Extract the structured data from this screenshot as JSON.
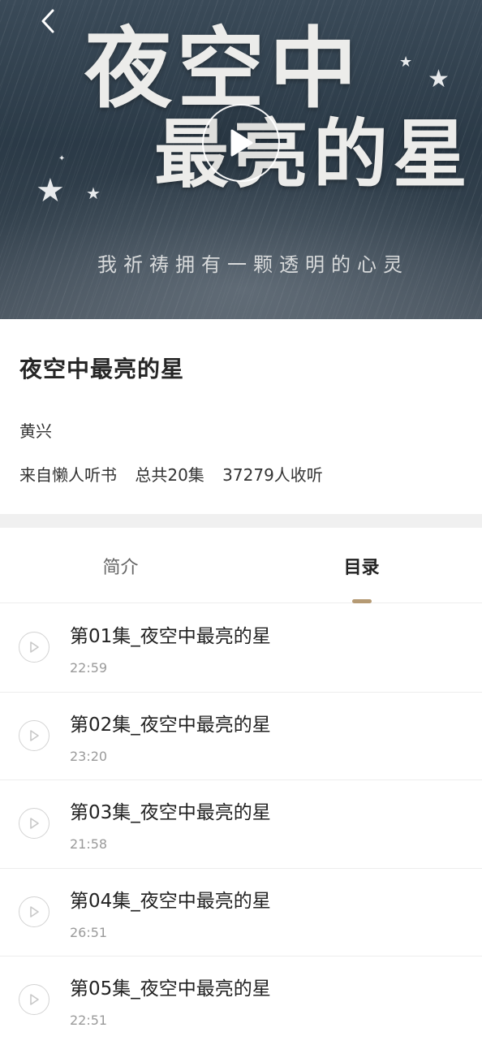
{
  "cover": {
    "title_line1": "夜空中",
    "title_line2": "最亮的星",
    "subtitle": "我祈祷拥有一颗透明的心灵",
    "back_icon": "chevron-left-icon",
    "play_icon": "play-icon"
  },
  "book": {
    "title": "夜空中最亮的星",
    "author": "黄兴",
    "source": "来自懒人听书",
    "episode_count": "总共20集",
    "listeners": "37279人收听"
  },
  "tabs": [
    {
      "label": "简介",
      "active": false
    },
    {
      "label": "目录",
      "active": true
    }
  ],
  "colors": {
    "accent": "#b59a73",
    "divider": "#f0f0f0"
  },
  "episodes": [
    {
      "title": "第01集_夜空中最亮的星",
      "duration": "22:59"
    },
    {
      "title": "第02集_夜空中最亮的星",
      "duration": "23:20"
    },
    {
      "title": "第03集_夜空中最亮的星",
      "duration": "21:58"
    },
    {
      "title": "第04集_夜空中最亮的星",
      "duration": "26:51"
    },
    {
      "title": "第05集_夜空中最亮的星",
      "duration": "22:51"
    }
  ]
}
